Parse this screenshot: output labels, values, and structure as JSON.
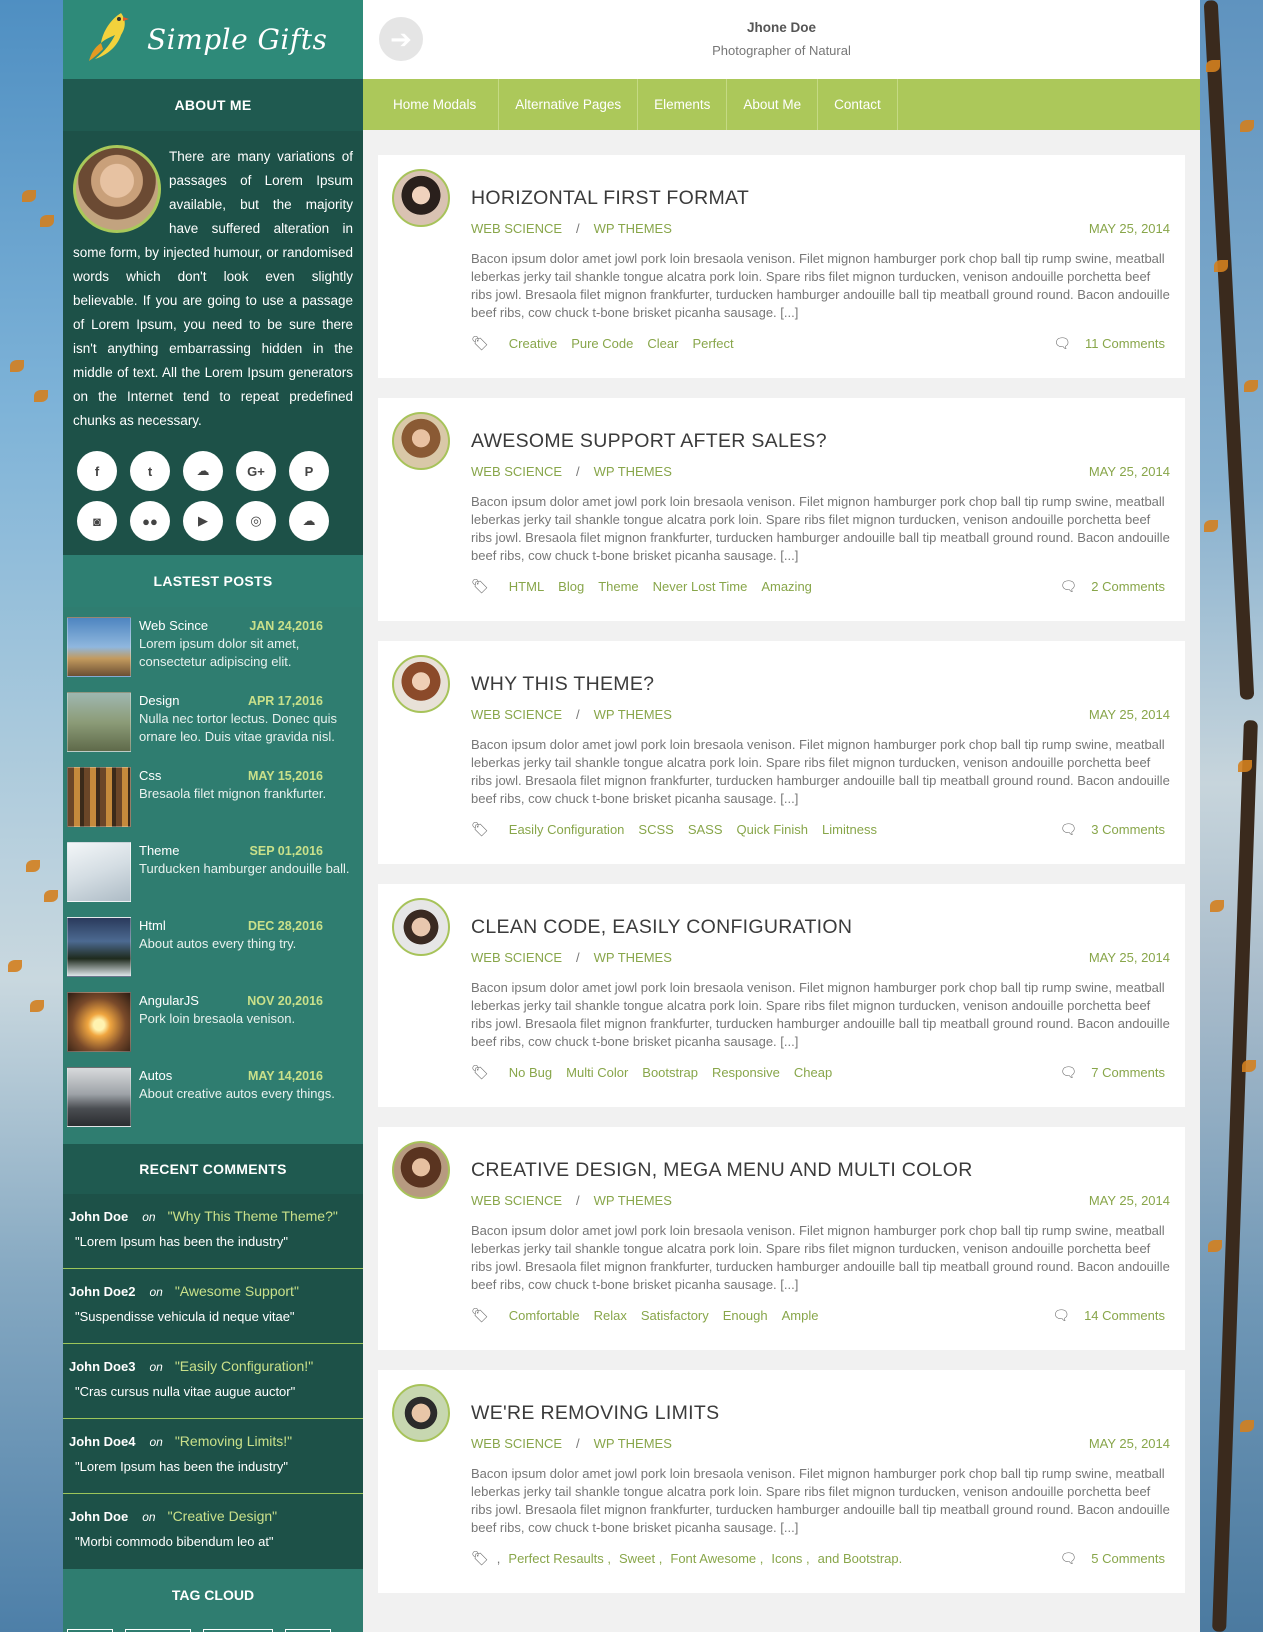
{
  "brand": {
    "logo_text": "Simple Gifts"
  },
  "sidebar": {
    "about_heading": "ABOUT ME",
    "about_text": "There are many variations of passages of Lorem Ipsum available, but the majority have suffered alteration in some form, by injected humour, or randomised words which don't look even slightly believable. If you are going to use a passage of Lorem Ipsum, you need to be sure there isn't anything embarrassing hidden in the middle of text. All the Lorem Ipsum generators on the Internet tend to repeat predefined chunks as necessary.",
    "social": [
      {
        "icon": "facebook-icon",
        "glyph": "f"
      },
      {
        "icon": "twitter-icon",
        "glyph": "t"
      },
      {
        "icon": "soundcloud-icon",
        "glyph": "☁"
      },
      {
        "icon": "google-plus-icon",
        "glyph": "G+"
      },
      {
        "icon": "pinterest-icon",
        "glyph": "P"
      },
      {
        "icon": "instagram-icon",
        "glyph": "◙"
      },
      {
        "icon": "flickr-icon",
        "glyph": "●●"
      },
      {
        "icon": "youtube-icon",
        "glyph": "▶"
      },
      {
        "icon": "dribbble-icon",
        "glyph": "◎"
      },
      {
        "icon": "cloud-icon",
        "glyph": "☁"
      }
    ],
    "latest_heading": "LASTEST POSTS",
    "latest_posts": [
      {
        "title": "Web Scince",
        "date": "JAN 24,2016",
        "desc": "Lorem ipsum dolor sit amet, consectetur adipiscing elit."
      },
      {
        "title": "Design",
        "date": "APR 17,2016",
        "desc": "Nulla nec tortor lectus. Donec quis ornare leo. Duis vitae gravida nisl."
      },
      {
        "title": "Css",
        "date": "MAY 15,2016",
        "desc": "Bresaola filet mignon frankfurter."
      },
      {
        "title": "Theme",
        "date": "SEP 01,2016",
        "desc": "Turducken hamburger andouille ball."
      },
      {
        "title": "Html",
        "date": "DEC 28,2016",
        "desc": "About autos every thing try."
      },
      {
        "title": "AngularJS",
        "date": "NOV 20,2016",
        "desc": "Pork loin bresaola venison."
      },
      {
        "title": "Autos",
        "date": "MAY 14,2016",
        "desc": "About creative autos every things."
      }
    ],
    "comments_heading": "RECENT COMMENTS",
    "comments": [
      {
        "author": "John Doe",
        "on": "on",
        "ref": "\"Why This Theme Theme?\"",
        "text": "\"Lorem Ipsum has been the industry\""
      },
      {
        "author": "John Doe2",
        "on": "on",
        "ref": "\"Awesome Support\"",
        "text": "\"Suspendisse vehicula id neque vitae\""
      },
      {
        "author": "John Doe3",
        "on": "on",
        "ref": "\"Easily Configuration!\"",
        "text": "\"Cras cursus nulla vitae augue auctor\""
      },
      {
        "author": "John Doe4",
        "on": "on",
        "ref": "\"Removing Limits!\"",
        "text": "\"Lorem Ipsum has been the industry\""
      },
      {
        "author": "John Doe",
        "on": "on",
        "ref": "\"Creative Design\"",
        "text": "\"Morbi commodo bibendum leo at\""
      }
    ],
    "tag_cloud_heading": "TAG CLOUD"
  },
  "header": {
    "name": "Jhone Doe",
    "role": "Photographer of Natural"
  },
  "nav": [
    "Home Modals",
    "Alternative Pages",
    "Elements",
    "About Me",
    "Contact"
  ],
  "articles": [
    {
      "title": "HORIZONTAL FIRST FORMAT",
      "cat1": "WEB SCIENCE",
      "sep": "/",
      "cat2": "WP THEMES",
      "date": "MAY 25, 2014",
      "text": "Bacon ipsum dolor amet jowl pork loin bresaola venison. Filet mignon hamburger pork chop ball tip rump swine, meatball leberkas jerky tail shankle tongue alcatra pork loin. Spare ribs filet mignon turducken, venison andouille porchetta beef ribs jowl. Bresaola filet mignon frankfurter, turducken hamburger andouille ball tip meatball ground round. Bacon andouille beef ribs, cow chuck t-bone brisket picanha sausage. [...]",
      "tags": [
        "Creative",
        "Pure Code",
        "Clear",
        "Perfect"
      ],
      "comments": "11 Comments"
    },
    {
      "title": "AWESOME SUPPORT AFTER SALES?",
      "cat1": "WEB SCIENCE",
      "sep": "/",
      "cat2": "WP THEMES",
      "date": "MAY 25, 2014",
      "text": "Bacon ipsum dolor amet jowl pork loin bresaola venison. Filet mignon hamburger pork chop ball tip rump swine, meatball leberkas jerky tail shankle tongue alcatra pork loin. Spare ribs filet mignon turducken, venison andouille porchetta beef ribs jowl. Bresaola filet mignon frankfurter, turducken hamburger andouille ball tip meatball ground round. Bacon andouille beef ribs, cow chuck t-bone brisket picanha sausage. [...]",
      "tags": [
        "HTML",
        "Blog",
        "Theme",
        "Never Lost Time",
        "Amazing"
      ],
      "comments": "2 Comments"
    },
    {
      "title": "WHY THIS THEME?",
      "cat1": "WEB SCIENCE",
      "sep": "/",
      "cat2": "WP THEMES",
      "date": "MAY 25, 2014",
      "text": "Bacon ipsum dolor amet jowl pork loin bresaola venison. Filet mignon hamburger pork chop ball tip rump swine, meatball leberkas jerky tail shankle tongue alcatra pork loin. Spare ribs filet mignon turducken, venison andouille porchetta beef ribs jowl. Bresaola filet mignon frankfurter, turducken hamburger andouille ball tip meatball ground round. Bacon andouille beef ribs, cow chuck t-bone brisket picanha sausage. [...]",
      "tags": [
        "Easily Configuration",
        "SCSS",
        "SASS",
        "Quick Finish",
        "Limitness"
      ],
      "comments": "3 Comments"
    },
    {
      "title": "CLEAN CODE, EASILY CONFIGURATION",
      "cat1": "WEB SCIENCE",
      "sep": "/",
      "cat2": "WP THEMES",
      "date": "MAY 25, 2014",
      "text": "Bacon ipsum dolor amet jowl pork loin bresaola venison. Filet mignon hamburger pork chop ball tip rump swine, meatball leberkas jerky tail shankle tongue alcatra pork loin. Spare ribs filet mignon turducken, venison andouille porchetta beef ribs jowl. Bresaola filet mignon frankfurter, turducken hamburger andouille ball tip meatball ground round. Bacon andouille beef ribs, cow chuck t-bone brisket picanha sausage. [...]",
      "tags": [
        "No Bug",
        "Multi Color",
        "Bootstrap",
        "Responsive",
        "Cheap"
      ],
      "comments": "7 Comments"
    },
    {
      "title": "CREATIVE DESIGN, MEGA MENU AND MULTI COLOR",
      "cat1": "WEB SCIENCE",
      "sep": "/",
      "cat2": "WP THEMES",
      "date": "MAY 25, 2014",
      "text": "Bacon ipsum dolor amet jowl pork loin bresaola venison. Filet mignon hamburger pork chop ball tip rump swine, meatball leberkas jerky tail shankle tongue alcatra pork loin. Spare ribs filet mignon turducken, venison andouille porchetta beef ribs jowl. Bresaola filet mignon frankfurter, turducken hamburger andouille ball tip meatball ground round. Bacon andouille beef ribs, cow chuck t-bone brisket picanha sausage. [...]",
      "tags": [
        "Comfortable",
        "Relax",
        "Satisfactory",
        "Enough",
        "Ample"
      ],
      "comments": "14 Comments"
    },
    {
      "title": "WE'RE REMOVING LIMITS",
      "cat1": "WEB SCIENCE",
      "sep": "/",
      "cat2": "WP THEMES",
      "date": "MAY 25, 2014",
      "text": "Bacon ipsum dolor amet jowl pork loin bresaola venison. Filet mignon hamburger pork chop ball tip rump swine, meatball leberkas jerky tail shankle tongue alcatra pork loin. Spare ribs filet mignon turducken, venison andouille porchetta beef ribs jowl. Bresaola filet mignon frankfurter, turducken hamburger andouille ball tip meatball ground round. Bacon andouille beef ribs, cow chuck t-bone brisket picanha sausage. [...]",
      "tags": [
        ",",
        "Perfect Resaults ,",
        "Sweet ,",
        "Font Awesome ,",
        "Icons ,",
        "and Bootstrap."
      ],
      "comments": "5 Comments"
    }
  ],
  "colors": {
    "accent_green": "#acc85a",
    "link_green": "#88a64a",
    "sidebar_teal": "#2f7d70",
    "sidebar_dark": "#1d5148"
  }
}
